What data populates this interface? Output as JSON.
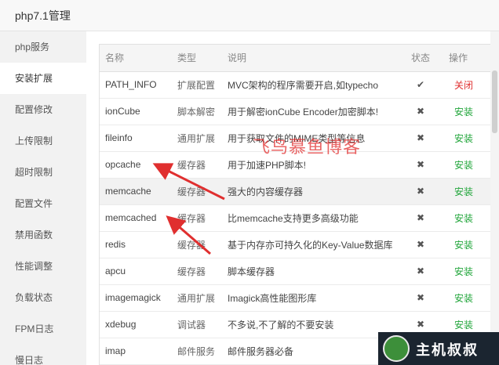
{
  "window": {
    "title": "php7.1管理"
  },
  "sidebar": {
    "items": [
      {
        "label": "php服务",
        "active": false
      },
      {
        "label": "安装扩展",
        "active": true
      },
      {
        "label": "配置修改",
        "active": false
      },
      {
        "label": "上传限制",
        "active": false
      },
      {
        "label": "超时限制",
        "active": false
      },
      {
        "label": "配置文件",
        "active": false
      },
      {
        "label": "禁用函数",
        "active": false
      },
      {
        "label": "性能调整",
        "active": false
      },
      {
        "label": "负载状态",
        "active": false
      },
      {
        "label": "FPM日志",
        "active": false
      },
      {
        "label": "慢日志",
        "active": false
      }
    ]
  },
  "table": {
    "headers": {
      "name": "名称",
      "type": "类型",
      "desc": "说明",
      "status": "状态",
      "op": "操作"
    },
    "rows": [
      {
        "name": "PATH_INFO",
        "type": "扩展配置",
        "desc": "MVC架构的程序需要开启,如typecho",
        "status": "✔",
        "op": "关闭",
        "op_kind": "close",
        "highlight": false
      },
      {
        "name": "ionCube",
        "type": "脚本解密",
        "desc": "用于解密ionCube Encoder加密脚本!",
        "status": "✖",
        "op": "安装",
        "op_kind": "install",
        "highlight": false
      },
      {
        "name": "fileinfo",
        "type": "通用扩展",
        "desc": "用于获取文件的MIME类型等信息",
        "status": "✖",
        "op": "安装",
        "op_kind": "install",
        "highlight": false
      },
      {
        "name": "opcache",
        "type": "缓存器",
        "desc": "用于加速PHP脚本!",
        "status": "✖",
        "op": "安装",
        "op_kind": "install",
        "highlight": false
      },
      {
        "name": "memcache",
        "type": "缓存器",
        "desc": "强大的内容缓存器",
        "status": "✖",
        "op": "安装",
        "op_kind": "install",
        "highlight": true
      },
      {
        "name": "memcached",
        "type": "缓存器",
        "desc": "比memcache支持更多高级功能",
        "status": "✖",
        "op": "安装",
        "op_kind": "install",
        "highlight": false
      },
      {
        "name": "redis",
        "type": "缓存器",
        "desc": "基于内存亦可持久化的Key-Value数据库",
        "status": "✖",
        "op": "安装",
        "op_kind": "install",
        "highlight": false
      },
      {
        "name": "apcu",
        "type": "缓存器",
        "desc": "脚本缓存器",
        "status": "✖",
        "op": "安装",
        "op_kind": "install",
        "highlight": false
      },
      {
        "name": "imagemagick",
        "type": "通用扩展",
        "desc": "Imagick高性能图形库",
        "status": "✖",
        "op": "安装",
        "op_kind": "install",
        "highlight": false
      },
      {
        "name": "xdebug",
        "type": "调试器",
        "desc": "不多说,不了解的不要安装",
        "status": "✖",
        "op": "安装",
        "op_kind": "install",
        "highlight": false
      },
      {
        "name": "imap",
        "type": "邮件服务",
        "desc": "邮件服务器必备",
        "status": "",
        "op": "",
        "op_kind": "install",
        "highlight": false
      }
    ]
  },
  "watermark": {
    "text": "飞鸟慕鱼博客"
  },
  "badge": {
    "text": "主机叔叔"
  },
  "colors": {
    "install": "#20a53a",
    "close": "#e02f2f",
    "annotation_arrow": "#e02f2f"
  }
}
